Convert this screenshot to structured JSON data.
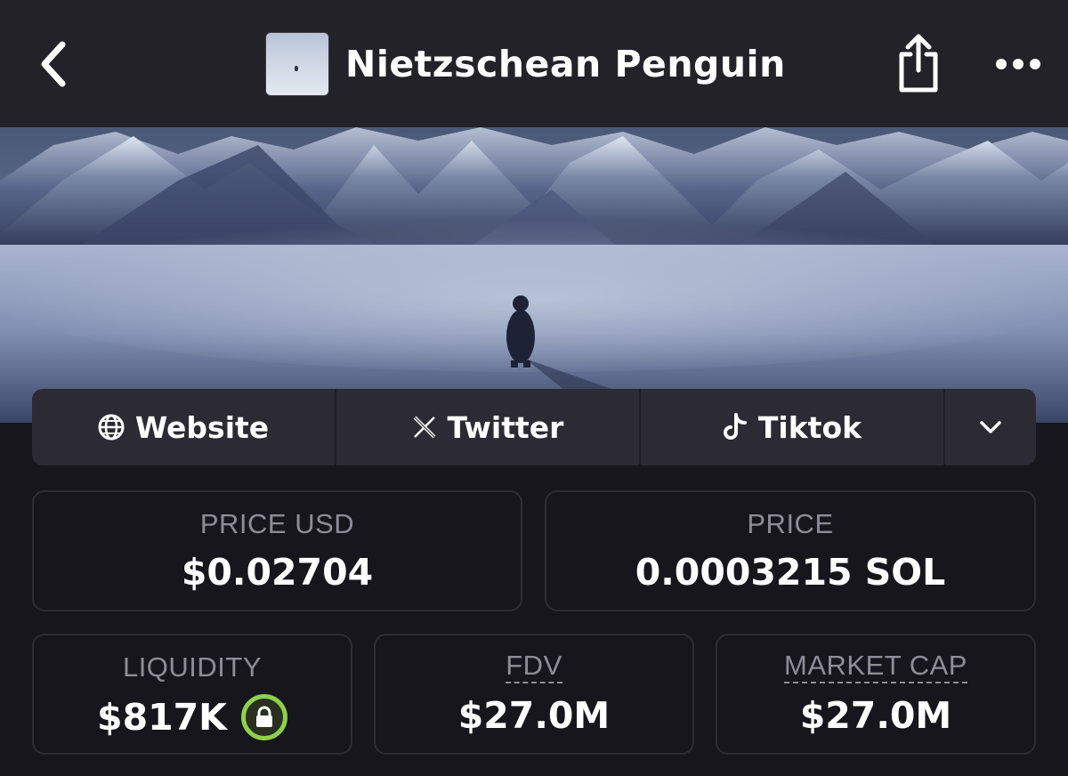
{
  "header": {
    "title": "Nietzschean Penguin",
    "back_icon": "chevron-left-icon",
    "share_icon": "share-icon",
    "more_icon": "ellipsis-icon"
  },
  "links": [
    {
      "label": "Website",
      "icon": "globe-icon"
    },
    {
      "label": "Twitter",
      "icon": "x-logo-icon"
    },
    {
      "label": "Tiktok",
      "icon": "tiktok-icon"
    }
  ],
  "links_more_icon": "chevron-down-icon",
  "stats": {
    "price_usd": {
      "label": "PRICE USD",
      "value": "$0.02704"
    },
    "price": {
      "label": "PRICE",
      "value": "0.0003215 SOL"
    },
    "liquidity": {
      "label": "LIQUIDITY",
      "value": "$817K",
      "locked": true,
      "lock_color": "#8ed14a"
    },
    "fdv": {
      "label": "FDV",
      "value": "$27.0M"
    },
    "market_cap": {
      "label": "MARKET CAP",
      "value": "$27.0M"
    }
  },
  "colors": {
    "background": "#17161c",
    "header_bg": "#232229",
    "card_border": "#2e2d35",
    "label": "#8e8d97"
  }
}
